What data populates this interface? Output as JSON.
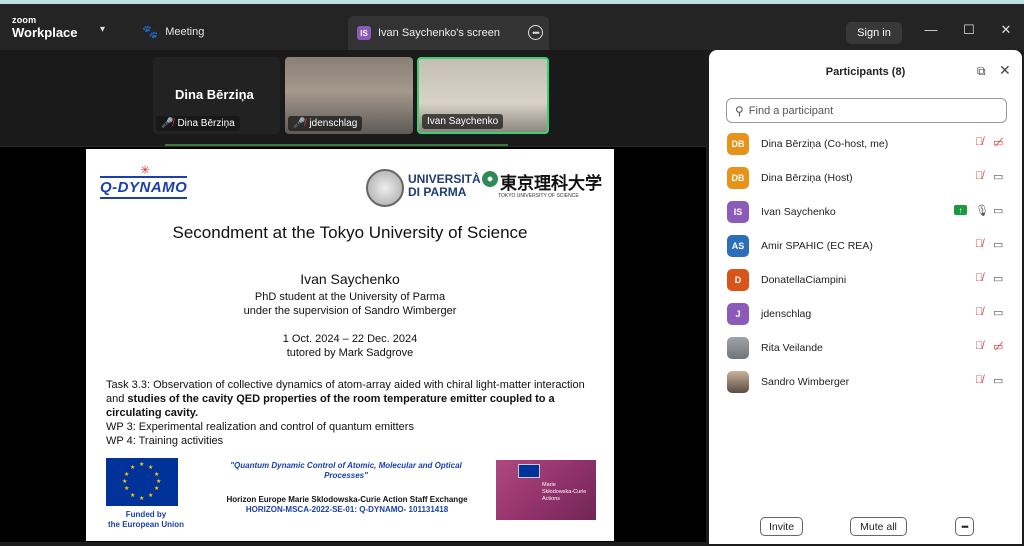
{
  "app": {
    "brand_small": "zoom",
    "brand_big": "Workplace",
    "meeting_label": "Meeting",
    "screen_tab_badge": "IS",
    "screen_tab_label": "Ivan Saychenko's screen",
    "signin_label": "Sign in"
  },
  "videos": [
    {
      "big_name": "Dina Bērziņa",
      "label": "Dina Bērziņa",
      "muted": true
    },
    {
      "label": "jdenschlag",
      "muted": true
    },
    {
      "label": "Ivan Saychenko",
      "muted": false,
      "active_speaker": true
    }
  ],
  "slide": {
    "qdynamo_logo": "Q-DYNAMO",
    "unipr_line1": "UNIVERSITÀ",
    "unipr_line2": "DI PARMA",
    "tus_logo": "東京理科大学",
    "tus_sub": "TOKYO UNIVERSITY OF SCIENCE",
    "title": "Secondment at the Tokyo University of Science",
    "name": "Ivan Saychenko",
    "line1": "PhD student at the University of Parma",
    "line2": "under the supervision of Sandro Wimberger",
    "dates": "1 Oct. 2024 – 22 Dec. 2024",
    "tutor": "tutored by Mark Sadgrove",
    "task_normal": "Task 3.3: Observation of collective dynamics of atom-array aided with chiral light-matter interaction and ",
    "task_bold": "studies of the cavity QED properties of the room temperature emitter coupled to a circulating cavity.",
    "wp3": "WP 3: Experimental realization and control of quantum emitters",
    "wp4": "WP 4: Training activities",
    "eu_funded_1": "Funded by",
    "eu_funded_2": "the European Union",
    "project_quote": "\"Quantum Dynamic Control of Atomic, Molecular and Optical Processes\"",
    "horizon_line": "Horizon Europe Marie Sklodowska-Curie Action Staff Exchange",
    "horizon_id": "HORIZON-MSCA-2022-SE-01: Q-DYNAMO- 101131418",
    "msca_1": "Marie",
    "msca_2": "Skłodowska-Curie",
    "msca_3": "Actions"
  },
  "participants": {
    "title": "Participants (8)",
    "search_placeholder": "Find a participant",
    "list": [
      {
        "initials": "DB",
        "name": "Dina Bērziņa (Co-host, me)",
        "color": "#e8921a",
        "mic": "muted",
        "cam": "off"
      },
      {
        "initials": "DB",
        "name": "Dina Bērziņa (Host)",
        "color": "#e8921a",
        "mic": "muted",
        "cam": "on"
      },
      {
        "initials": "IS",
        "name": "Ivan Saychenko",
        "color": "#8c5ab8",
        "mic": "on",
        "cam": "on",
        "sharing": true
      },
      {
        "initials": "AS",
        "name": "Amir SPAHIC (EC REA)",
        "color": "#2a6fb8",
        "mic": "muted",
        "cam": "on"
      },
      {
        "initials": "D",
        "name": "DonatellaCiampini",
        "color": "#d9541a",
        "mic": "muted",
        "cam": "on"
      },
      {
        "initials": "J",
        "name": "jdenschlag",
        "color": "#8c5ab8",
        "mic": "muted",
        "cam": "on"
      },
      {
        "initials": "",
        "name": "Rita Veilande",
        "color": "photo",
        "mic": "muted",
        "cam": "off"
      },
      {
        "initials": "",
        "name": "Sandro Wimberger",
        "color": "photo2",
        "mic": "muted",
        "cam": "on"
      }
    ],
    "invite_label": "Invite",
    "muteall_label": "Mute all"
  }
}
